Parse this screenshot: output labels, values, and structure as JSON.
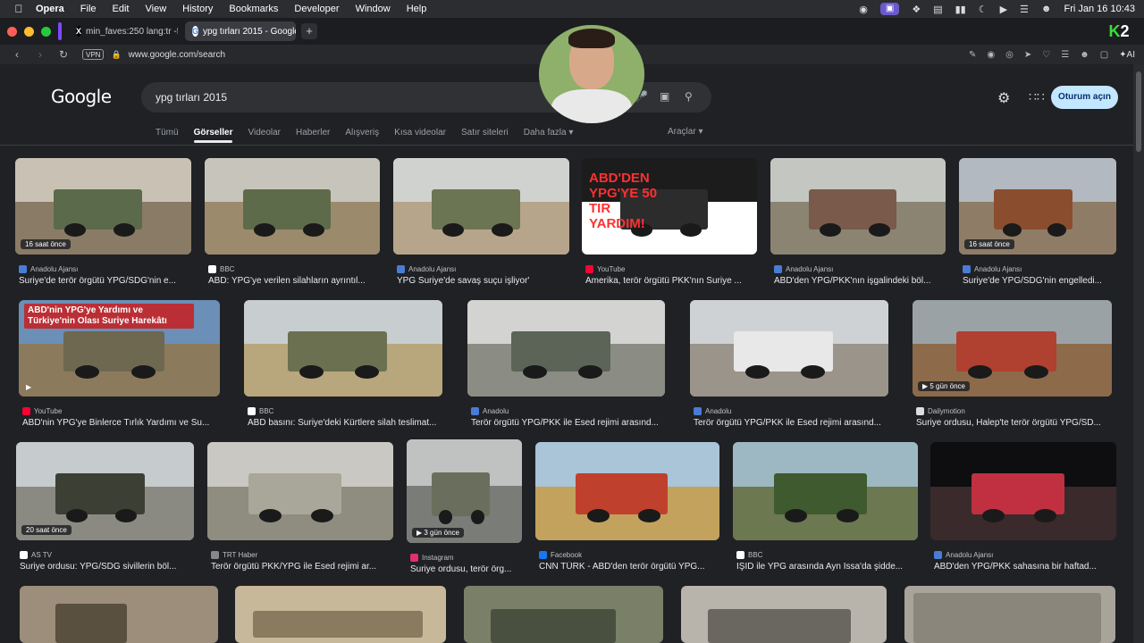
{
  "menubar": {
    "app": "Opera",
    "items": [
      "File",
      "Edit",
      "View",
      "History",
      "Bookmarks",
      "Developer",
      "Window",
      "Help"
    ],
    "clock": "Fri Jan 16  10:43"
  },
  "tabs": [
    {
      "label": "min_faves:250 lang:tr -f",
      "icon": "x-logo-icon"
    },
    {
      "label": "ypg tırları 2015 - Google",
      "icon": "google-icon"
    }
  ],
  "address": {
    "vpn": "VPN",
    "url": "www.google.com/search",
    "ai_label": "AI"
  },
  "google": {
    "logo": "Google",
    "query": "ypg tırları 2015",
    "signin": "Oturum açın",
    "filters": [
      "Tümü",
      "Görseller",
      "Videolar",
      "Haberler",
      "Alışveriş",
      "Kısa videolar",
      "Satır siteleri",
      "Daha fazla"
    ],
    "tools": "Araçlar"
  },
  "results": [
    {
      "source": "Anadolu Ajansı",
      "title": "Suriye'de terör örgütü YPG/SDG'nin e...",
      "badge": "16 saat önce",
      "video": false,
      "fav": "#4a7cd6"
    },
    {
      "source": "BBC",
      "title": "ABD: YPG'ye verilen silahların ayrıntıl...",
      "badge": "",
      "video": false,
      "fav": "#ffffff"
    },
    {
      "source": "Anadolu Ajansı",
      "title": "YPG Suriye'de savaş suçu işliyor'",
      "badge": "",
      "video": false,
      "fav": "#4a7cd6"
    },
    {
      "source": "YouTube",
      "title": "Amerika, terör örgütü PKK'nın Suriye ...",
      "badge": "",
      "video": true,
      "fav": "#ff0033",
      "overlay": "ABD'DEN YPG'YE 50 TIR YARDIM!"
    },
    {
      "source": "Anadolu Ajansı",
      "title": "ABD'den YPG/PKK'nın işgalindeki böl...",
      "badge": "",
      "video": false,
      "fav": "#4a7cd6"
    },
    {
      "source": "Anadolu Ajansı",
      "title": "Suriye'de YPG/SDG'nin engelledi...",
      "badge": "16 saat önce",
      "video": false,
      "fav": "#4a7cd6"
    },
    {
      "source": "YouTube",
      "title": "ABD'nin YPG'ye Binlerce Tırlık Yardımı ve Su...",
      "badge": "",
      "video": true,
      "fav": "#ff0033",
      "overlay": "ABD'nin YPG'ye Yardımı ve Türkiye'nin Olası Suriye Harekâtı"
    },
    {
      "source": "BBC",
      "title": "ABD basını: Suriye'deki Kürtlere silah teslimat...",
      "badge": "",
      "video": false,
      "fav": "#ffffff"
    },
    {
      "source": "Anadolu",
      "title": "Terör örgütü YPG/PKK ile Esed rejimi arasınd...",
      "badge": "",
      "video": false,
      "fav": "#4a7cd6"
    },
    {
      "source": "Anadolu",
      "title": "Terör örgütü YPG/PKK ile Esed rejimi arasınd...",
      "badge": "",
      "video": false,
      "fav": "#4a7cd6"
    },
    {
      "source": "Dailymotion",
      "title": "Suriye ordusu, Halep'te terör örgütü YPG/SD...",
      "badge": "5 gün önce",
      "video": true,
      "fav": "#dddddd"
    },
    {
      "source": "AS TV",
      "title": "Suriye ordusu: YPG/SDG sivillerin böl...",
      "badge": "20 saat önce",
      "video": false,
      "fav": "#ffffff"
    },
    {
      "source": "TRT Haber",
      "title": "Terör örgütü PKK/YPG ile Esed rejimi ar...",
      "badge": "",
      "video": false,
      "fav": "#888888"
    },
    {
      "source": "Instagram",
      "title": "Suriye ordusu, terör örg...",
      "badge": "3 gün önce",
      "video": true,
      "fav": "#e1306c"
    },
    {
      "source": "Facebook",
      "title": "CNN TÜRK - ABD'den terör örgütü YPG...",
      "badge": "",
      "video": false,
      "fav": "#1877f2"
    },
    {
      "source": "BBC",
      "title": "IŞİD ile YPG arasında Ayn İssa'da şidde...",
      "badge": "",
      "video": false,
      "fav": "#ffffff"
    },
    {
      "source": "Anadolu Ajansı",
      "title": "ABD'den YPG/PKK sahasına bir haftad...",
      "badge": "",
      "video": false,
      "fav": "#4a7cd6"
    }
  ]
}
